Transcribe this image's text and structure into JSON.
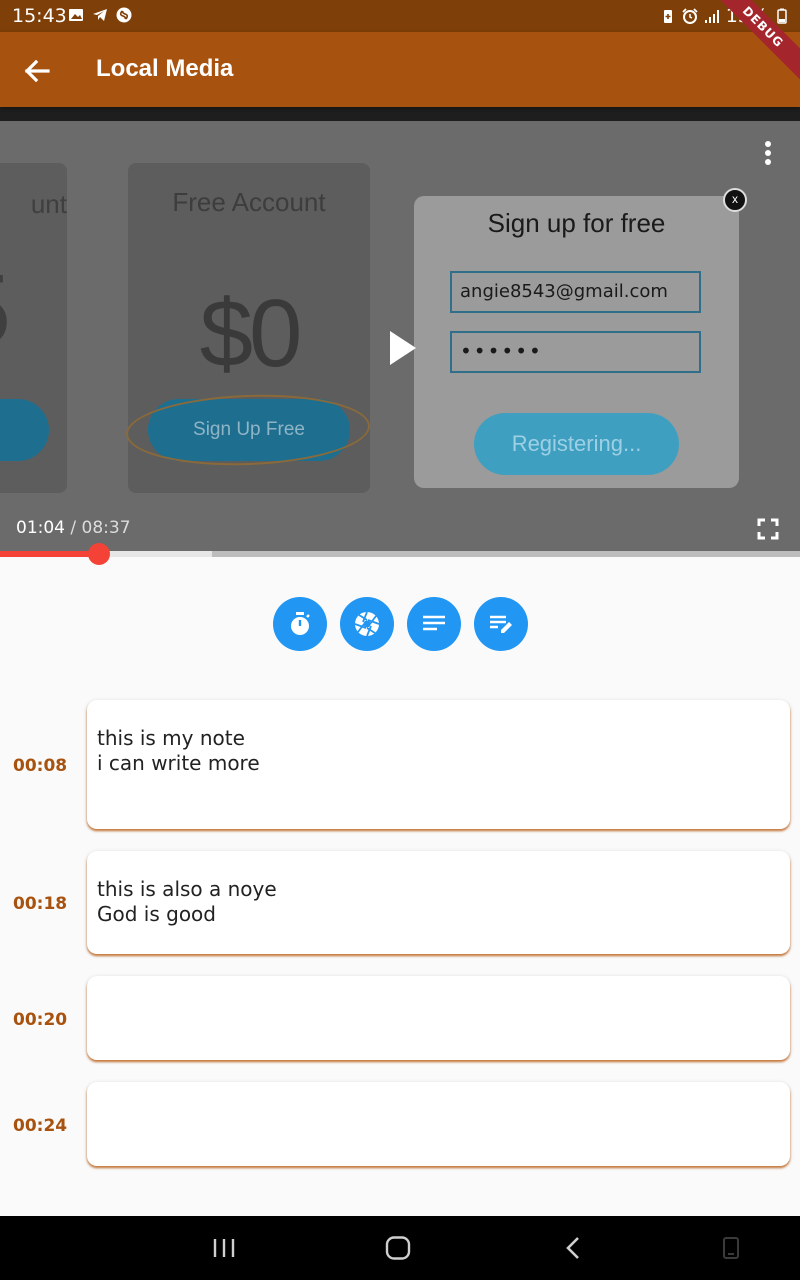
{
  "status_bar": {
    "time": "15:43",
    "battery": "15%",
    "icons": [
      "gallery-icon",
      "telegram-icon",
      "shazam-icon",
      "battery-saver-icon",
      "alarm-icon",
      "signal-icon",
      "battery-icon"
    ]
  },
  "debug_banner": "DEBUG",
  "app_bar": {
    "title": "Local Media"
  },
  "video": {
    "partial_card": {
      "header": "unt",
      "price": "5"
    },
    "free_card": {
      "header": "Free Account",
      "price": "$0",
      "button": "Sign Up Free"
    },
    "modal": {
      "title": "Sign up for free",
      "email": "angie8543@gmail.com",
      "password": "••••••",
      "button": "Registering...",
      "close": "x"
    },
    "current_time": "01:04",
    "separator": " / ",
    "total_time": "08:37",
    "progress_played_fraction": 0.124
  },
  "actions": [
    {
      "name": "timer-icon"
    },
    {
      "name": "camera-shutter-icon"
    },
    {
      "name": "notes-icon"
    },
    {
      "name": "edit-note-icon"
    }
  ],
  "notes": [
    {
      "time": "00:08",
      "line1": "this is my note",
      "line2": "i can write more"
    },
    {
      "time": "00:18",
      "line1": "this is also a noye",
      "line2": "God is good"
    },
    {
      "time": "00:20",
      "line1": "",
      "line2": ""
    },
    {
      "time": "00:24",
      "line1": "",
      "line2": ""
    }
  ],
  "colors": {
    "status_bar": "#7e3f08",
    "app_bar": "#a8520f",
    "accent_blue": "#2196f3",
    "progress_red": "#f44336",
    "note_time": "#a8520f"
  }
}
